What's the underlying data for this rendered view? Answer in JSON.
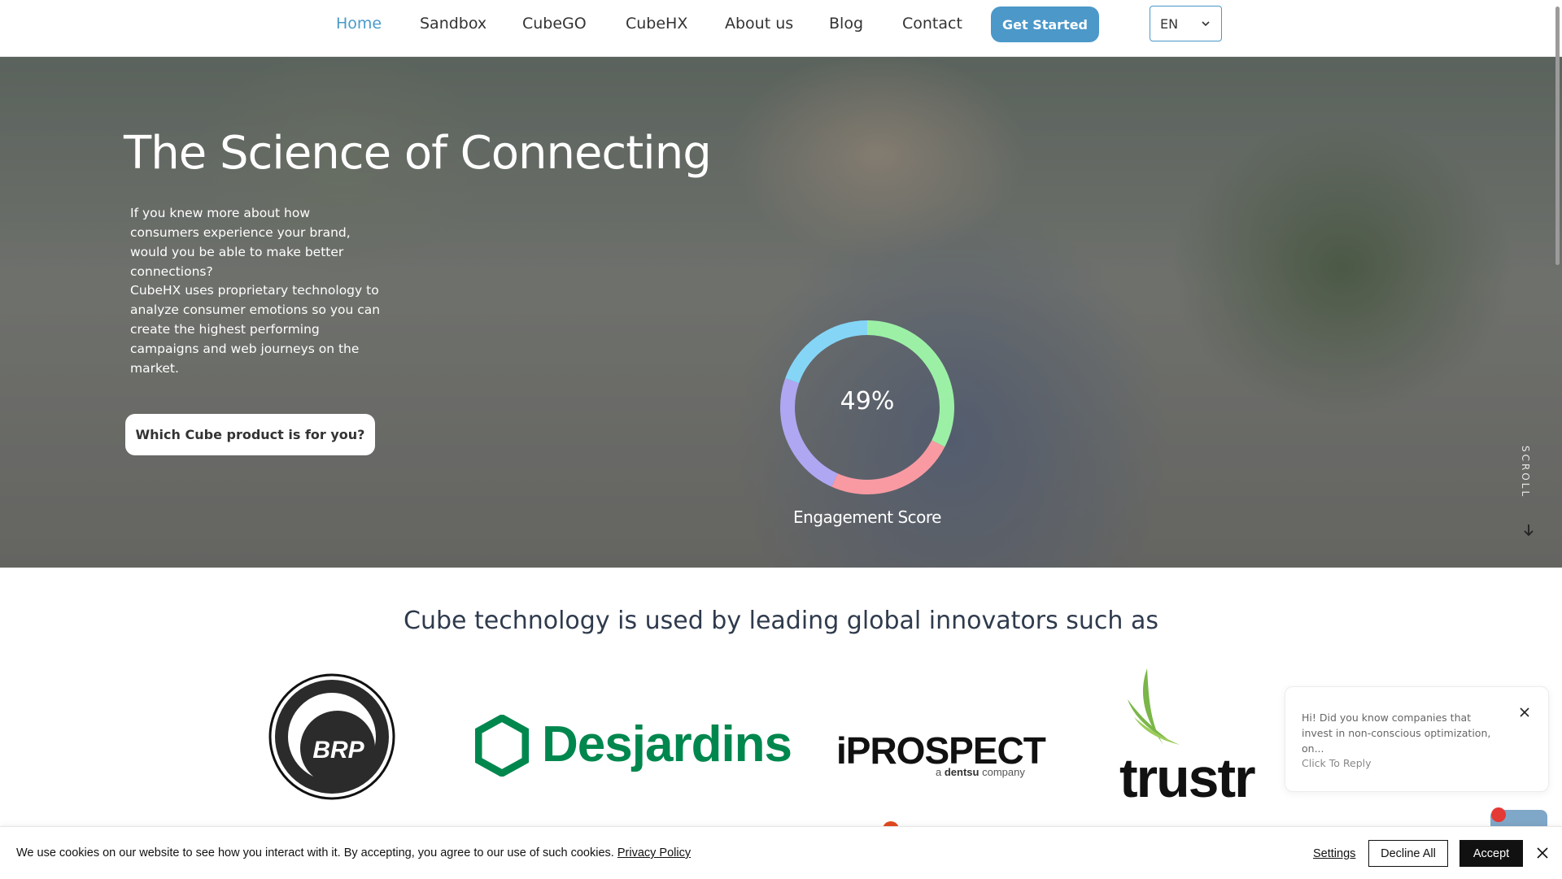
{
  "nav": {
    "items": [
      {
        "label": "Home",
        "active": true
      },
      {
        "label": "Sandbox",
        "active": false
      },
      {
        "label": "CubeGO",
        "active": false
      },
      {
        "label": "CubeHX",
        "active": false
      },
      {
        "label": "About us",
        "active": false
      },
      {
        "label": "Blog",
        "active": false
      },
      {
        "label": "Contact",
        "active": false
      }
    ],
    "cta_label": "Get Started",
    "language": {
      "selected": "EN",
      "icon": "chevron-down-icon"
    }
  },
  "hero": {
    "title": "The Science of Connecting",
    "paragraph1": "If you knew more about how consumers experience your brand, would you be able to make better connections?",
    "paragraph2": "CubeHX uses proprietary technology to analyze consumer emotions so you can create the highest performing campaigns and web journeys on the market.",
    "button_label": "Which Cube product is for you?",
    "engagement": {
      "value": "49%",
      "label": "Engagement Score",
      "ring_colors": [
        "#9cf0a6",
        "#f99aa2",
        "#b0a7f2",
        "#85d5f6"
      ]
    },
    "scroll_label": "SCROLL",
    "scroll_icon": "arrow-down-icon"
  },
  "innovators": {
    "heading": "Cube technology is used by leading global innovators such as",
    "logos": [
      {
        "name": "BRP",
        "text": "BRP"
      },
      {
        "name": "Desjardins",
        "text": "Desjardins",
        "color": "#00874e"
      },
      {
        "name": "iProspect",
        "text": "iPROSPECT",
        "subtext_prefix": "a",
        "subtext_brand": "dentsu",
        "subtext_suffix": "company"
      },
      {
        "name": "trustr",
        "text": "trustr",
        "mark_color": "#7ab648"
      }
    ]
  },
  "chat": {
    "message": "Hi! Did you know companies that invest in non-conscious optimization, on...",
    "reply_label": "Click To Reply",
    "close_icon": "close-icon"
  },
  "cookie": {
    "text": "We use cookies on our website to see how you interact with it. By accepting, you agree to our use of such cookies.",
    "policy_link": "Privacy Policy",
    "settings_label": "Settings",
    "decline_label": "Decline All",
    "accept_label": "Accept",
    "close_icon": "close-icon"
  }
}
